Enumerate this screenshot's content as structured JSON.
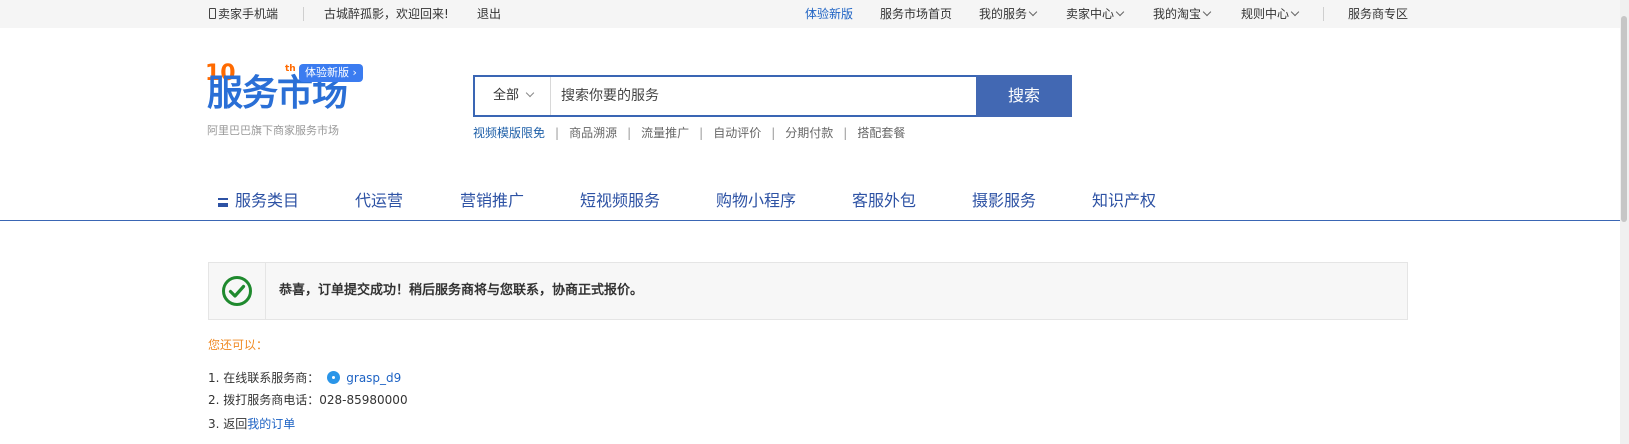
{
  "topbar": {
    "mobile": "卖家手机端",
    "greeting": "古城醉孤影，欢迎回来!",
    "logout": "退出",
    "new_version": "体验新版",
    "market_home": "服务市场首页",
    "my_services": "我的服务",
    "seller_center": "卖家中心",
    "my_taobao": "我的淘宝",
    "rules_center": "规则中心",
    "provider_zone": "服务商专区"
  },
  "logo": {
    "ten": "10",
    "th": "th",
    "title": "服务市场",
    "badge": "体验新版 ›",
    "subtitle": "阿里巴巴旗下商家服务市场"
  },
  "search": {
    "category": "全部",
    "placeholder": "搜索你要的服务",
    "button": "搜索"
  },
  "hotwords": [
    "视频模版限免",
    "商品溯源",
    "流量推广",
    "自动评价",
    "分期付款",
    "搭配套餐"
  ],
  "nav": [
    "服务类目",
    "代运营",
    "营销推广",
    "短视频服务",
    "购物小程序",
    "客服外包",
    "摄影服务",
    "知识产权"
  ],
  "success": {
    "message": "恭喜，订单提交成功！稍后服务商将与您联系，协商正式报价。"
  },
  "next": {
    "heading": "您还可以：",
    "step1_label": "1. 在线联系服务商：",
    "step1_name": "grasp_d9",
    "step2": "2. 拨打服务商电话：028-85980000",
    "step3_label": "3. 返回",
    "step3_link": "我的订单"
  }
}
